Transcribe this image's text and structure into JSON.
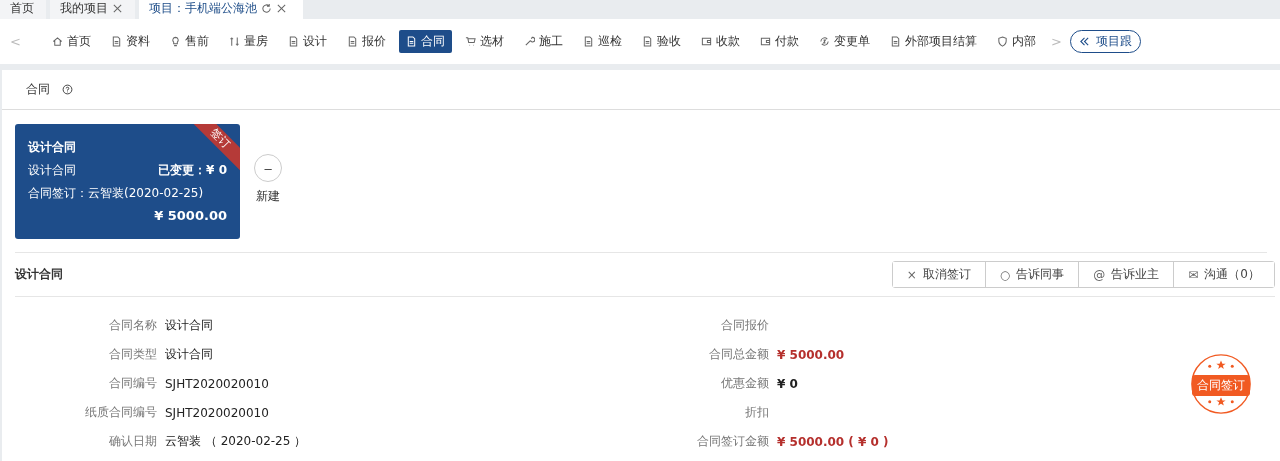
{
  "tabs": [
    {
      "label": "首页",
      "selected": false,
      "closable": false,
      "refresh": false
    },
    {
      "label": "我的项目",
      "selected": false,
      "closable": true,
      "refresh": false
    },
    {
      "label": "项目：手机端公海池",
      "selected": true,
      "closable": true,
      "refresh": true
    }
  ],
  "nav": {
    "prev": "<",
    "next": ">",
    "items": [
      {
        "label": "首页",
        "selected": false
      },
      {
        "label": "资料",
        "selected": false
      },
      {
        "label": "售前",
        "selected": false
      },
      {
        "label": "量房",
        "selected": false
      },
      {
        "label": "设计",
        "selected": false
      },
      {
        "label": "报价",
        "selected": false
      },
      {
        "label": "合同",
        "selected": true
      },
      {
        "label": "选材",
        "selected": false
      },
      {
        "label": "施工",
        "selected": false
      },
      {
        "label": "巡检",
        "selected": false
      },
      {
        "label": "验收",
        "selected": false
      },
      {
        "label": "收款",
        "selected": false
      },
      {
        "label": "付款",
        "selected": false
      },
      {
        "label": "变更单",
        "selected": false
      },
      {
        "label": "外部项目结算",
        "selected": false
      },
      {
        "label": "内部",
        "selected": false
      }
    ],
    "track_button": "项目跟"
  },
  "page_title": "合同",
  "contract_card": {
    "title": "设计合同",
    "ribbon": "签订",
    "type": "设计合同",
    "changed": "已变更：¥ 0",
    "signed": "合同签订：云智装(2020-02-25)",
    "amount": "¥ 5000.00"
  },
  "new_button": {
    "icon": "–",
    "label": "新建"
  },
  "section_title": "设计合同",
  "actions": [
    {
      "icon": "×",
      "label": "取消签订"
    },
    {
      "icon": "○",
      "label": "告诉同事"
    },
    {
      "icon": "@",
      "label": "告诉业主"
    },
    {
      "icon": "✉",
      "label": "沟通（0）"
    }
  ],
  "details_left": [
    {
      "label": "合同名称",
      "value": "设计合同"
    },
    {
      "label": "合同类型",
      "value": "设计合同"
    },
    {
      "label": "合同编号",
      "value": "SJHT2020020010"
    },
    {
      "label": "纸质合同编号",
      "value": "SJHT2020020010"
    },
    {
      "label": "确认日期",
      "value": "云智装 （ 2020-02-25 ）"
    }
  ],
  "details_right": [
    {
      "label": "合同报价"
    },
    {
      "label": "合同总金额",
      "value": "¥ 5000.00",
      "kind": "money"
    },
    {
      "label": "优惠金额",
      "value": "¥ 0",
      "kind": "figure"
    },
    {
      "label": "折扣"
    },
    {
      "label": "合同签订金额",
      "value": "¥ 5000.00 ( ¥ 0 )",
      "kind": "money"
    }
  ],
  "stamp": "合同签订"
}
